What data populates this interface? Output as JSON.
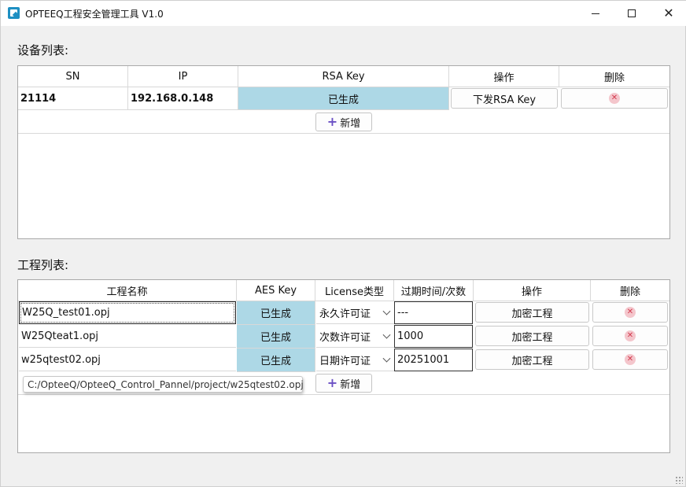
{
  "window": {
    "title": "OPTEEQ工程安全管理工具 V1.0"
  },
  "devices": {
    "section_label": "设备列表:",
    "headers": [
      "SN",
      "IP",
      "RSA Key",
      "操作",
      "删除"
    ],
    "rows": [
      {
        "sn": "21114",
        "ip": "192.168.0.148",
        "rsa_status": "已生成",
        "action_label": "下发RSA Key"
      }
    ],
    "add_label": "新增"
  },
  "projects": {
    "section_label": "工程列表:",
    "headers": [
      "工程名称",
      "AES Key",
      "License类型",
      "过期时间/次数",
      "操作",
      "删除"
    ],
    "rows": [
      {
        "name": "W25Q_test01.opj",
        "aes_status": "已生成",
        "license_type": "永久许可证",
        "expiry": "---",
        "action_label": "加密工程"
      },
      {
        "name": "W25Qteat1.opj",
        "aes_status": "已生成",
        "license_type": "次数许可证",
        "expiry": "1000",
        "action_label": "加密工程"
      },
      {
        "name": "w25qtest02.opj",
        "aes_status": "已生成",
        "license_type": "日期许可证",
        "expiry": "20251001",
        "action_label": "加密工程"
      }
    ],
    "add_label": "新增",
    "tooltip": "C:/OpteeQ/OpteeQ_Control_Pannel/project/w25qtest02.opj"
  },
  "colors": {
    "status_cell": "#add8e6",
    "delete_icon": "#d23a4e",
    "add_icon": "#6a4fc4"
  }
}
